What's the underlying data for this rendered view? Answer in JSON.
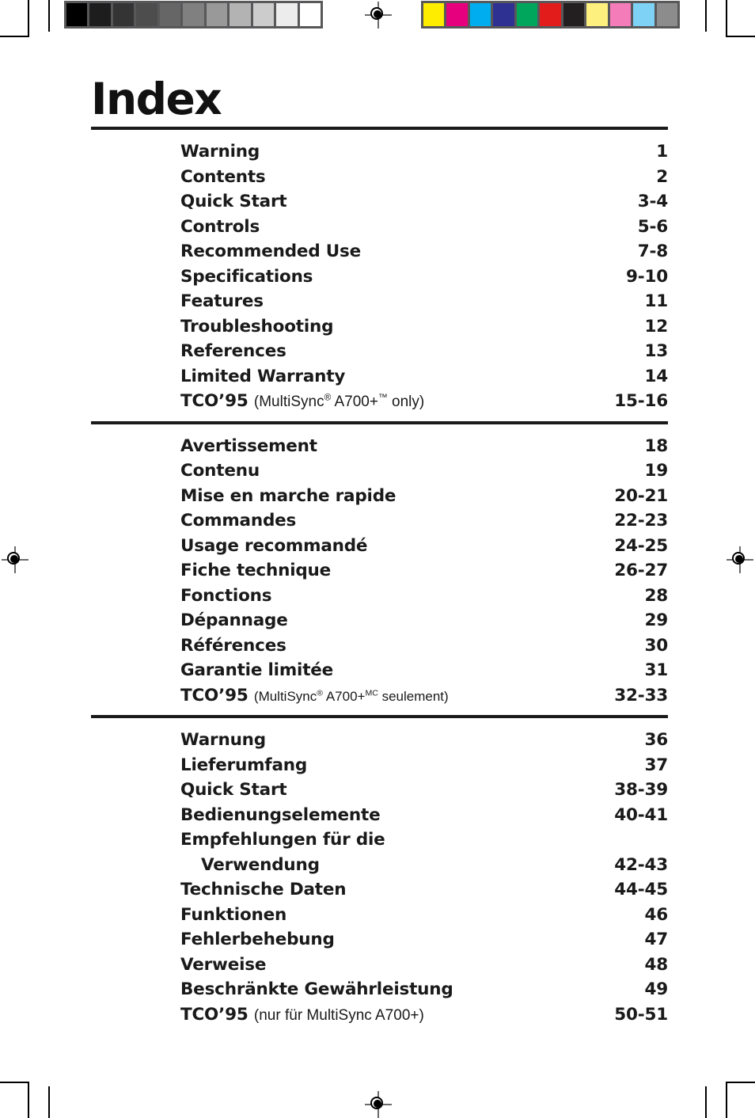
{
  "page_title": "Index",
  "calibration": {
    "grayscale_bar": {
      "name": "grayscale-step-wedge",
      "swatches": [
        "#000000",
        "#1d1d1d",
        "#343434",
        "#4d4d4d",
        "#666666",
        "#808080",
        "#999999",
        "#b3b3b3",
        "#cccccc",
        "#ececec",
        "#ffffff"
      ]
    },
    "color_bar": {
      "name": "process-color-bar",
      "swatches": [
        "#ffed00",
        "#e6007e",
        "#00aeef",
        "#2e3192",
        "#00a65b",
        "#e21b1b",
        "#231f20",
        "#fdf07f",
        "#f47cb8",
        "#7dd2f5",
        "#8c8c8c"
      ]
    },
    "separator_color": "#58585a"
  },
  "sections": [
    {
      "id": "english",
      "entries": [
        {
          "label": "Warning",
          "pages": "1"
        },
        {
          "label": "Contents",
          "pages": "2"
        },
        {
          "label": "Quick Start",
          "pages": "3-4"
        },
        {
          "label": "Controls",
          "pages": "5-6"
        },
        {
          "label": "Recommended Use",
          "pages": "7-8"
        },
        {
          "label": "Specifications",
          "pages": "9-10"
        },
        {
          "label": "Features",
          "pages": "11"
        },
        {
          "label": "Troubleshooting",
          "pages": "12"
        },
        {
          "label": "References",
          "pages": "13"
        },
        {
          "label": "Limited Warranty",
          "pages": "14"
        },
        {
          "type": "tco",
          "lead": "TCO’95",
          "note_open": "(MultiSync",
          "sup1": "®",
          "note_mid": " A700+",
          "sup2": "™",
          "note_close": " only)",
          "pages": "15-16"
        }
      ]
    },
    {
      "id": "french",
      "entries": [
        {
          "label": "Avertissement",
          "pages": "18"
        },
        {
          "label": "Contenu",
          "pages": "19"
        },
        {
          "label": "Mise en marche rapide",
          "pages": "20-21"
        },
        {
          "label": "Commandes",
          "pages": "22-23"
        },
        {
          "label": "Usage recommandé",
          "pages": "24-25"
        },
        {
          "label": "Fiche technique",
          "pages": "26-27"
        },
        {
          "label": "Fonctions",
          "pages": "28"
        },
        {
          "label": "Dépannage",
          "pages": "29"
        },
        {
          "label": "Références",
          "pages": "30"
        },
        {
          "label": "Garantie limitée",
          "pages": "31"
        },
        {
          "type": "tco",
          "lead": "TCO’95",
          "note_open": "(MultiSync",
          "sup1": "®",
          "note_mid": " A700+",
          "sup2": "MC",
          "note_close": " seulement)",
          "pages": "32-33"
        }
      ]
    },
    {
      "id": "german",
      "entries": [
        {
          "label": "Warnung",
          "pages": "36"
        },
        {
          "label": "Lieferumfang",
          "pages": "37"
        },
        {
          "label": "Quick Start",
          "pages": "38-39"
        },
        {
          "label": "Bedienungselemente",
          "pages": "40-41"
        },
        {
          "label": "Empfehlungen für die",
          "pages": ""
        },
        {
          "label": "Verwendung",
          "pages": "42-43",
          "continuation": true
        },
        {
          "label": "Technische Daten",
          "pages": "44-45"
        },
        {
          "label": "Funktionen",
          "pages": "46"
        },
        {
          "label": "Fehlerbehebung",
          "pages": "47"
        },
        {
          "label": "Verweise",
          "pages": "48"
        },
        {
          "label": "Beschränkte Gewährleistung",
          "pages": "49"
        },
        {
          "type": "tco",
          "lead": "TCO’95",
          "note_open": "(nur für MultiSync A700+)",
          "sup1": "",
          "note_mid": "",
          "sup2": "",
          "note_close": "",
          "pages": "50-51"
        }
      ]
    }
  ]
}
